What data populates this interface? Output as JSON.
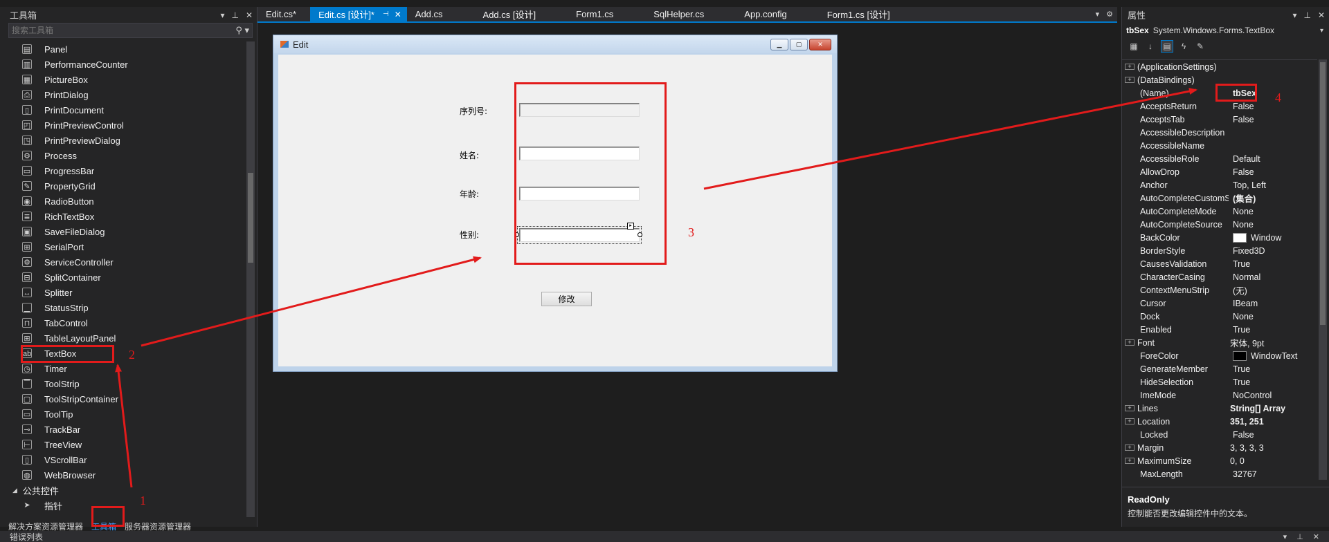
{
  "toolbox": {
    "title": "工具箱",
    "search_placeholder": "搜索工具箱",
    "items": [
      {
        "label": "Panel",
        "icon": "panel-icon"
      },
      {
        "label": "PerformanceCounter",
        "icon": "counter-icon"
      },
      {
        "label": "PictureBox",
        "icon": "picture-icon"
      },
      {
        "label": "PrintDialog",
        "icon": "print-icon"
      },
      {
        "label": "PrintDocument",
        "icon": "document-icon"
      },
      {
        "label": "PrintPreviewControl",
        "icon": "preview-icon"
      },
      {
        "label": "PrintPreviewDialog",
        "icon": "preview-dialog-icon"
      },
      {
        "label": "Process",
        "icon": "gears-icon"
      },
      {
        "label": "ProgressBar",
        "icon": "progress-icon"
      },
      {
        "label": "PropertyGrid",
        "icon": "wrench-icon"
      },
      {
        "label": "RadioButton",
        "icon": "radio-icon"
      },
      {
        "label": "RichTextBox",
        "icon": "richtext-icon"
      },
      {
        "label": "SaveFileDialog",
        "icon": "save-icon"
      },
      {
        "label": "SerialPort",
        "icon": "serialport-icon"
      },
      {
        "label": "ServiceController",
        "icon": "service-icon"
      },
      {
        "label": "SplitContainer",
        "icon": "split-icon"
      },
      {
        "label": "Splitter",
        "icon": "splitter-icon"
      },
      {
        "label": "StatusStrip",
        "icon": "statusstrip-icon"
      },
      {
        "label": "TabControl",
        "icon": "tab-icon"
      },
      {
        "label": "TableLayoutPanel",
        "icon": "table-icon"
      },
      {
        "label": "TextBox",
        "icon": "textbox-icon"
      },
      {
        "label": "Timer",
        "icon": "timer-icon"
      },
      {
        "label": "ToolStrip",
        "icon": "toolstrip-icon"
      },
      {
        "label": "ToolStripContainer",
        "icon": "toolstripcontainer-icon"
      },
      {
        "label": "ToolTip",
        "icon": "tooltip-icon"
      },
      {
        "label": "TrackBar",
        "icon": "trackbar-icon"
      },
      {
        "label": "TreeView",
        "icon": "tree-icon"
      },
      {
        "label": "VScrollBar",
        "icon": "vscroll-icon"
      },
      {
        "label": "WebBrowser",
        "icon": "globe-icon"
      }
    ],
    "group_label": "公共控件",
    "pointer_label": "指针",
    "bottom_tabs": [
      "解决方案资源管理器",
      "工具箱",
      "服务器资源管理器"
    ]
  },
  "editor": {
    "tabs": [
      {
        "label": "Edit.cs*"
      },
      {
        "label": "Edit.cs [设计]*",
        "active": true
      },
      {
        "label": "Add.cs"
      },
      {
        "label": "Add.cs [设计]"
      },
      {
        "label": "Form1.cs"
      },
      {
        "label": "SqlHelper.cs"
      },
      {
        "label": "App.config"
      },
      {
        "label": "Form1.cs [设计]"
      }
    ]
  },
  "form": {
    "title": "Edit",
    "labels": [
      "序列号:",
      "姓名:",
      "年龄:",
      "性别:"
    ],
    "button": "修改"
  },
  "properties": {
    "title": "属性",
    "object_name": "tbSex",
    "object_type": "System.Windows.Forms.TextBox",
    "rows": [
      {
        "name": "(ApplicationSettings)",
        "value": "",
        "expandable": true
      },
      {
        "name": "(DataBindings)",
        "value": "",
        "expandable": true
      },
      {
        "name": "(Name)",
        "value": "tbSex",
        "bold": true
      },
      {
        "name": "AcceptsReturn",
        "value": "False"
      },
      {
        "name": "AcceptsTab",
        "value": "False"
      },
      {
        "name": "AccessibleDescription",
        "value": ""
      },
      {
        "name": "AccessibleName",
        "value": ""
      },
      {
        "name": "AccessibleRole",
        "value": "Default"
      },
      {
        "name": "AllowDrop",
        "value": "False"
      },
      {
        "name": "Anchor",
        "value": "Top, Left"
      },
      {
        "name": "AutoCompleteCustomSource",
        "value": "(集合)",
        "bold": true
      },
      {
        "name": "AutoCompleteMode",
        "value": "None"
      },
      {
        "name": "AutoCompleteSource",
        "value": "None"
      },
      {
        "name": "BackColor",
        "value": "Window",
        "swatch": "#ffffff"
      },
      {
        "name": "BorderStyle",
        "value": "Fixed3D"
      },
      {
        "name": "CausesValidation",
        "value": "True"
      },
      {
        "name": "CharacterCasing",
        "value": "Normal"
      },
      {
        "name": "ContextMenuStrip",
        "value": "(无)"
      },
      {
        "name": "Cursor",
        "value": "IBeam"
      },
      {
        "name": "Dock",
        "value": "None"
      },
      {
        "name": "Enabled",
        "value": "True"
      },
      {
        "name": "Font",
        "value": "宋体, 9pt",
        "expandable": true
      },
      {
        "name": "ForeColor",
        "value": "WindowText",
        "swatch": "#000000"
      },
      {
        "name": "GenerateMember",
        "value": "True"
      },
      {
        "name": "HideSelection",
        "value": "True"
      },
      {
        "name": "ImeMode",
        "value": "NoControl"
      },
      {
        "name": "Lines",
        "value": "String[] Array",
        "bold": true,
        "expandable": true
      },
      {
        "name": "Location",
        "value": "351, 251",
        "bold": true,
        "expandable": true
      },
      {
        "name": "Locked",
        "value": "False"
      },
      {
        "name": "Margin",
        "value": "3, 3, 3, 3",
        "expandable": true
      },
      {
        "name": "MaximumSize",
        "value": "0, 0",
        "expandable": true
      },
      {
        "name": "MaxLength",
        "value": "32767"
      }
    ],
    "desc_title": "ReadOnly",
    "desc_text": "控制能否更改编辑控件中的文本。"
  },
  "error_list": {
    "title": "错误列表"
  },
  "annotations": [
    "1",
    "2",
    "3",
    "4"
  ],
  "colors": {
    "accent": "#007acc",
    "annotation": "#e21b1b",
    "bg": "#1e1e1e",
    "panel": "#252526"
  }
}
